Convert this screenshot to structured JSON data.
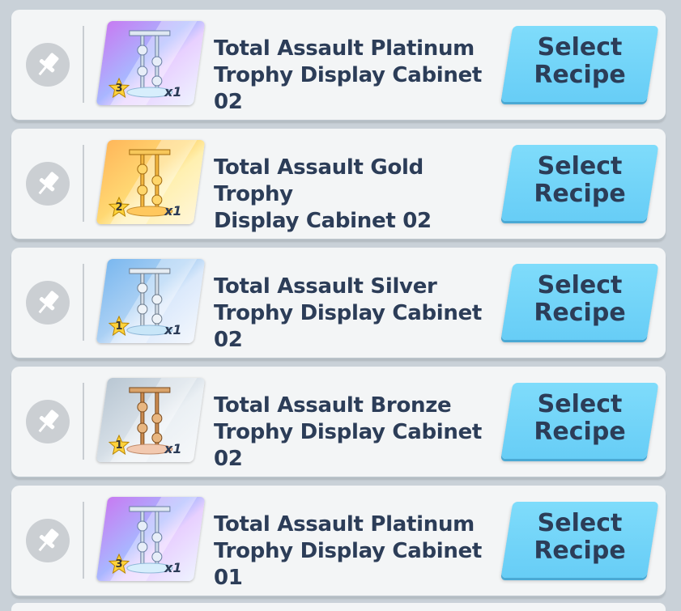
{
  "recipes": [
    {
      "name": "Total Assault Platinum Trophy Display Cabinet 02",
      "line1": "Total Assault Platinum",
      "line2": "Trophy Display Cabinet 02",
      "rarity": "3",
      "quantity": "x1",
      "tier": "platinum",
      "button": {
        "line1": "Select",
        "line2": "Recipe"
      }
    },
    {
      "name": "Total Assault Gold Trophy Display Cabinet 02",
      "line1": "Total Assault Gold Trophy",
      "line2": "Display Cabinet 02",
      "rarity": "2",
      "quantity": "x1",
      "tier": "gold",
      "button": {
        "line1": "Select",
        "line2": "Recipe"
      }
    },
    {
      "name": "Total Assault Silver Trophy Display Cabinet 02",
      "line1": "Total Assault Silver",
      "line2": "Trophy Display Cabinet 02",
      "rarity": "1",
      "quantity": "x1",
      "tier": "silver",
      "button": {
        "line1": "Select",
        "line2": "Recipe"
      }
    },
    {
      "name": "Total Assault Bronze Trophy Display Cabinet 02",
      "line1": "Total Assault Bronze",
      "line2": "Trophy Display Cabinet 02",
      "rarity": "1",
      "quantity": "x1",
      "tier": "bronze",
      "button": {
        "line1": "Select",
        "line2": "Recipe"
      }
    },
    {
      "name": "Total Assault Platinum Trophy Display Cabinet 01",
      "line1": "Total Assault Platinum",
      "line2": "Trophy Display Cabinet 01",
      "rarity": "3",
      "quantity": "x1",
      "tier": "platinum",
      "button": {
        "line1": "Select",
        "line2": "Recipe"
      }
    }
  ],
  "icons": {
    "pin": "pin-icon",
    "star": "star-icon",
    "cabinet": "trophy-cabinet-icon"
  },
  "colors": {
    "button": "#6fd3f8",
    "text": "#2c3d58",
    "row": "#f3f5f6",
    "background": "#c9d1d8"
  }
}
